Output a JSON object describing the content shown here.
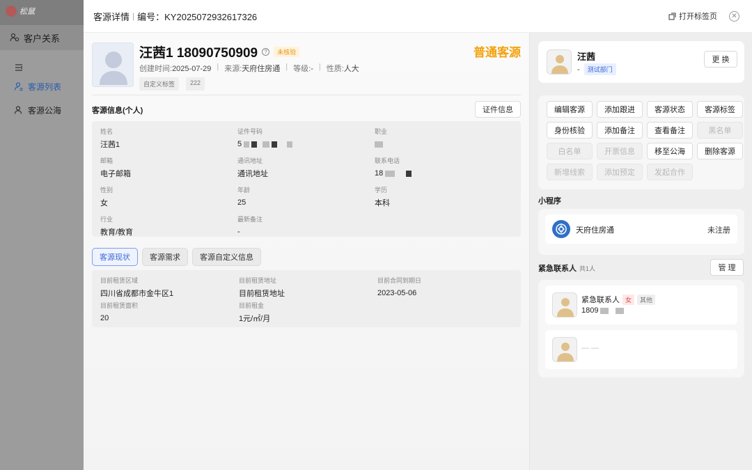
{
  "bg": {
    "logo_text": "松鼠",
    "module_title": "客户关系",
    "nav": [
      {
        "label": ""
      },
      {
        "label": "客源列表"
      },
      {
        "label": "客源公海"
      }
    ]
  },
  "header": {
    "title": "客源详情",
    "number_label": "编号：KY2025072932617326",
    "open_tab_label": "打开标签页"
  },
  "customer": {
    "name_phone": "汪茜1 18090750909",
    "verify_badge": "未核验",
    "grade": "普通客源",
    "created_label": "创建时间:",
    "created_value": "2025-07-29",
    "source_label": "来源:",
    "source_value": "天府住房通",
    "level_label": "等级:",
    "level_value": "-",
    "nature_label": "性质:",
    "nature_value": "人大",
    "tags": [
      "自定义标签",
      "222"
    ]
  },
  "info_section": {
    "title": "客源信息(个人)",
    "cert_button": "证件信息",
    "fields": {
      "name": {
        "label": "姓名",
        "value": "汪茜1"
      },
      "id_no": {
        "label": "证件号码",
        "value": "5"
      },
      "job": {
        "label": "职业",
        "value": ""
      },
      "email": {
        "label": "邮箱",
        "value": "电子邮箱"
      },
      "address": {
        "label": "通讯地址",
        "value": "通讯地址"
      },
      "phone": {
        "label": "联系电话",
        "value": "18"
      },
      "gender": {
        "label": "性别",
        "value": "女"
      },
      "age": {
        "label": "年龄",
        "value": "25"
      },
      "education": {
        "label": "学历",
        "value": "本科"
      },
      "industry": {
        "label": "行业",
        "value": "教育/教育"
      },
      "latest_note": {
        "label": "最新备注",
        "value": "-"
      }
    }
  },
  "subtabs": [
    "客源现状",
    "客源需求",
    "客源自定义信息"
  ],
  "status_fields": {
    "rent_area": {
      "label": "目前租赁区域",
      "value": "四川省成都市金牛区1"
    },
    "rent_addr": {
      "label": "目前租赁地址",
      "value": "目前租赁地址"
    },
    "contract_end": {
      "label": "目前合同到期日",
      "value": "2023-05-06"
    },
    "rent_size": {
      "label": "目前租赁面积",
      "value": "20"
    },
    "rent_price": {
      "label": "目前租金",
      "value": "1元/㎡/月"
    }
  },
  "owner": {
    "name": "汪茜",
    "sub": "-",
    "dept": "测试部门",
    "change_button": "更 换"
  },
  "actions": [
    {
      "label": "编辑客源",
      "enabled": true
    },
    {
      "label": "添加跟进",
      "enabled": true
    },
    {
      "label": "客源状态",
      "enabled": true
    },
    {
      "label": "客源标签",
      "enabled": true
    },
    {
      "label": "身份核验",
      "enabled": true
    },
    {
      "label": "添加备注",
      "enabled": true
    },
    {
      "label": "查看备注",
      "enabled": true
    },
    {
      "label": "黑名单",
      "enabled": false
    },
    {
      "label": "白名单",
      "enabled": false
    },
    {
      "label": "开票信息",
      "enabled": false
    },
    {
      "label": "移至公海",
      "enabled": true
    },
    {
      "label": "删除客源",
      "enabled": true
    },
    {
      "label": "新增线索",
      "enabled": false
    },
    {
      "label": "添加预定",
      "enabled": false
    },
    {
      "label": "发起合作",
      "enabled": false
    }
  ],
  "mini_program": {
    "title": "小程序",
    "name": "天府住房通",
    "status": "未注册"
  },
  "emergency": {
    "title": "紧急联系人",
    "count": "共1人",
    "manage_button": "管 理",
    "contacts": [
      {
        "name": "紧急联系人",
        "sex": "女",
        "relation": "其他",
        "phone": "1809"
      },
      {
        "empty": "— —"
      }
    ]
  },
  "colors": {
    "accent": "#3a66d6",
    "grade": "#f4a20c",
    "verify": "#e59a1a"
  }
}
